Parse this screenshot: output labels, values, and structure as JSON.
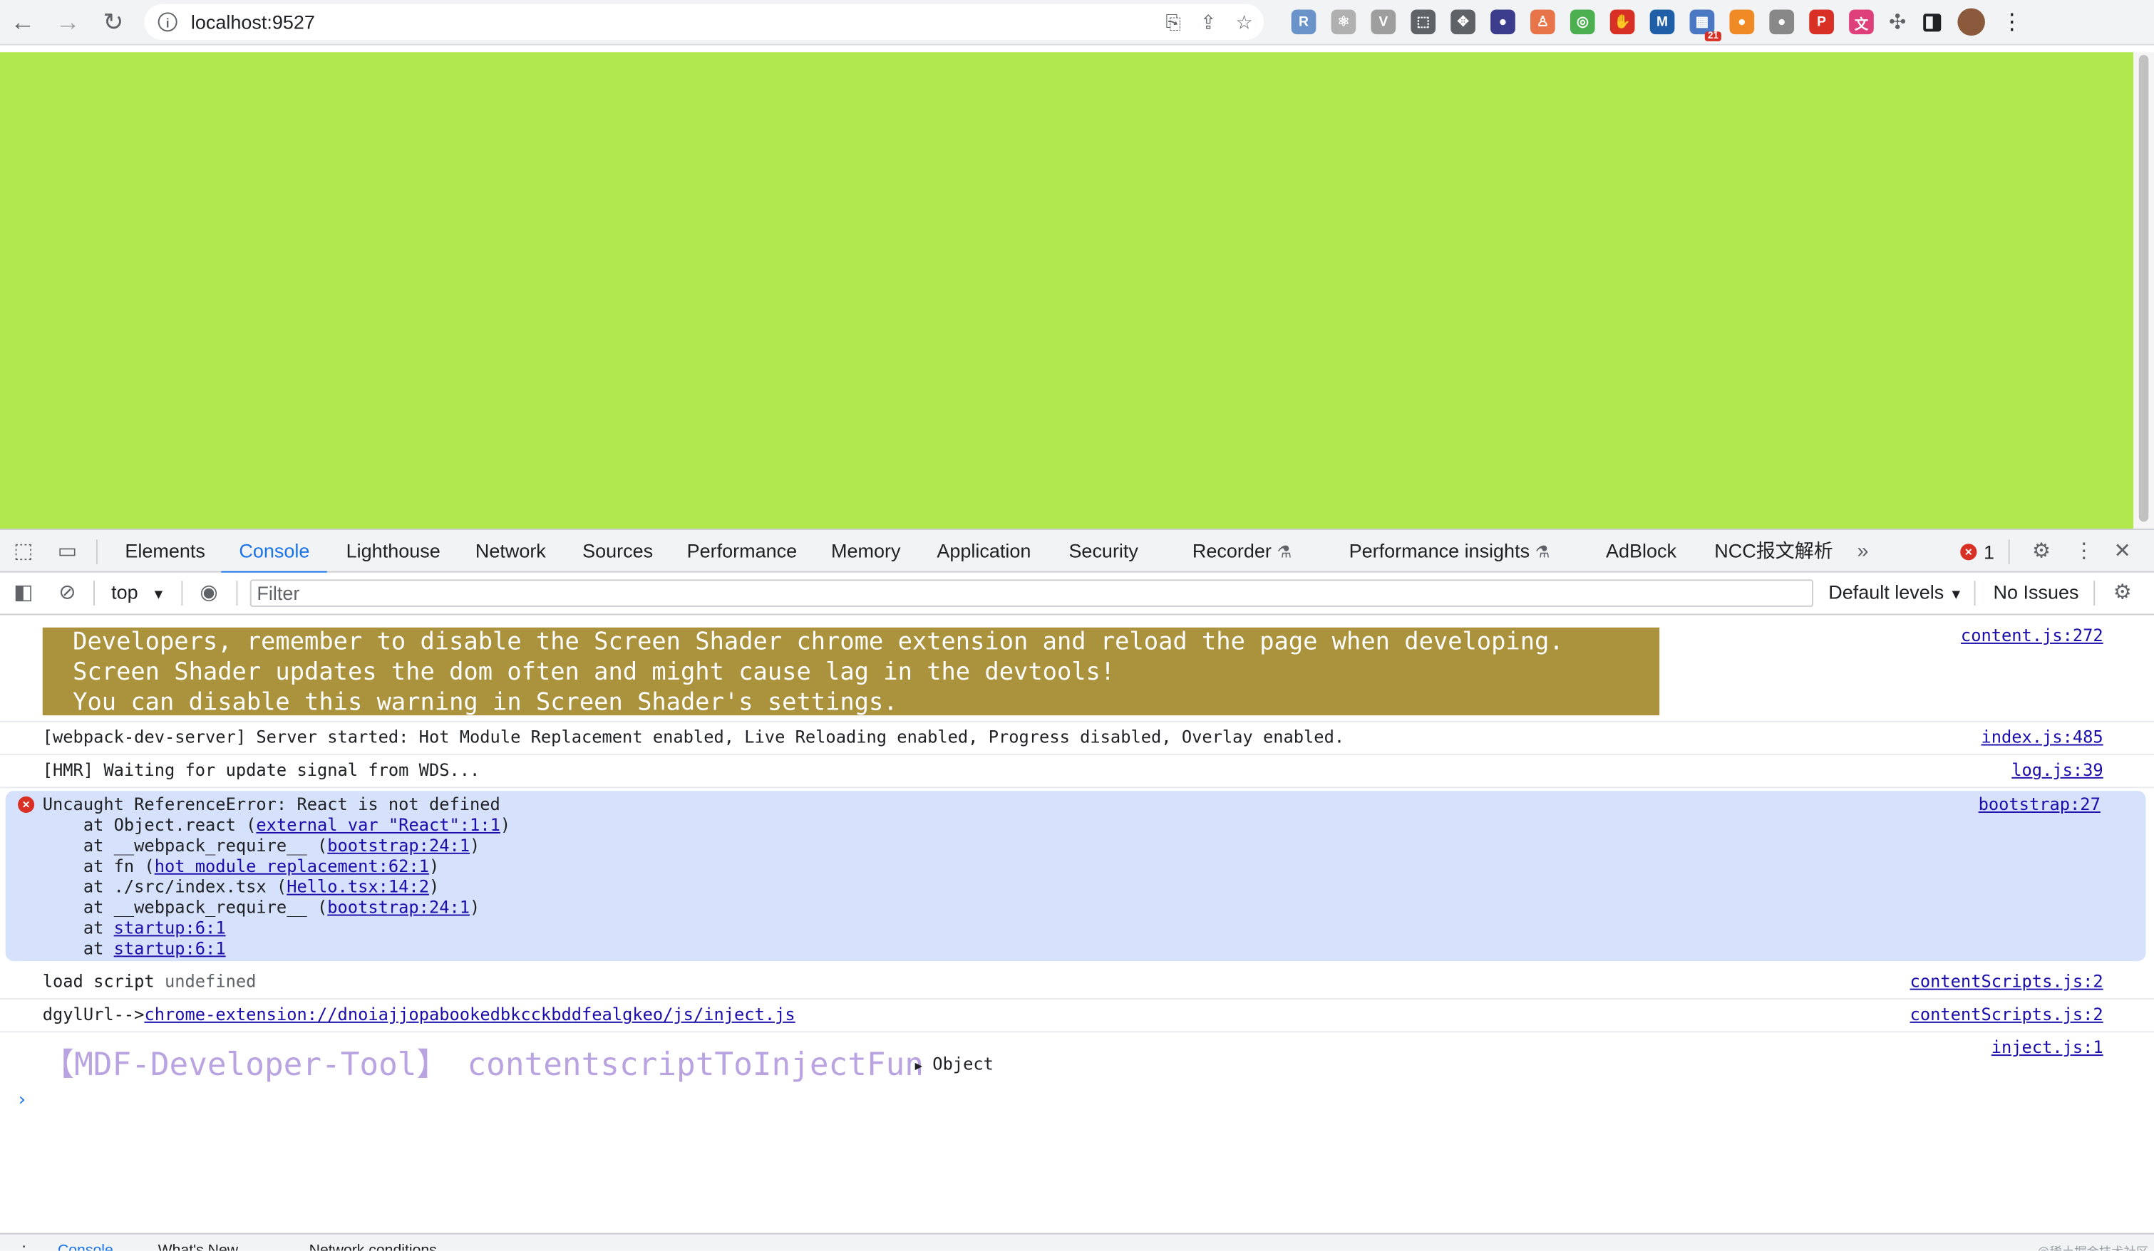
{
  "browser": {
    "url": "localhost:9527",
    "extensions": [
      {
        "icon": "r-ext-icon",
        "color": "#6a93c9",
        "glyph": "R"
      },
      {
        "icon": "react-devtools-icon",
        "color": "#b0b0b0",
        "glyph": "⚛"
      },
      {
        "icon": "vue-devtools-icon",
        "color": "#9e9e9e",
        "glyph": "V"
      },
      {
        "icon": "screenshot-icon",
        "color": "#5f6368",
        "glyph": "⬚"
      },
      {
        "icon": "move-icon",
        "color": "#5f6368",
        "glyph": "✥"
      },
      {
        "icon": "color-picker-icon",
        "color": "#3c3c8c",
        "glyph": "●"
      },
      {
        "icon": "hierarchy-icon",
        "color": "#e8744a",
        "glyph": "♙"
      },
      {
        "icon": "chrome-circle-icon",
        "color": "#4caf50",
        "glyph": "◎"
      },
      {
        "icon": "adblock-icon",
        "color": "#d93025",
        "glyph": "✋"
      },
      {
        "icon": "m-icon",
        "color": "#1f5fa8",
        "glyph": "M"
      },
      {
        "icon": "grid-badge-icon",
        "color": "#4a78c2",
        "glyph": "▦"
      },
      {
        "icon": "ball-icon",
        "color": "#f08a24",
        "glyph": "●"
      },
      {
        "icon": "gray-circle-icon",
        "color": "#888888",
        "glyph": "●"
      },
      {
        "icon": "pdf-icon",
        "color": "#d93025",
        "glyph": "P"
      },
      {
        "icon": "translate-ext-icon",
        "color": "#e0407a",
        "glyph": "文"
      }
    ],
    "badge": "21"
  },
  "devtools": {
    "tabs": [
      "Elements",
      "Console",
      "Lighthouse",
      "Network",
      "Sources",
      "Performance",
      "Memory",
      "Application",
      "Security",
      "Recorder",
      "Performance insights",
      "AdBlock",
      "NCC报文解析"
    ],
    "active_tab": "Console",
    "error_count": "1",
    "console_toolbar": {
      "context": "top",
      "filter_placeholder": "Filter",
      "levels": "Default levels",
      "issues": "No Issues"
    }
  },
  "console": {
    "banner": {
      "lines": [
        "Developers, remember to disable the Screen Shader chrome extension and reload the page when developing.",
        "Screen Shader updates the dom often and might cause lag in the devtools!",
        "You can disable this warning in Screen Shader's settings."
      ],
      "source": "content.js:272"
    },
    "wds": {
      "text": "[webpack-dev-server] Server started: Hot Module Replacement enabled, Live Reloading enabled, Progress disabled, Overlay enabled.",
      "source": "index.js:485"
    },
    "hmr": {
      "text": "[HMR] Waiting for update signal from WDS...",
      "source": "log.js:39"
    },
    "error": {
      "message": "Uncaught ReferenceError: React is not defined",
      "source": "bootstrap:27",
      "stack": [
        {
          "prefix": "    at Object.react (",
          "link": "external var \"React\":1:1",
          "suffix": ")"
        },
        {
          "prefix": "    at __webpack_require__ (",
          "link": "bootstrap:24:1",
          "suffix": ")"
        },
        {
          "prefix": "    at fn (",
          "link": "hot module replacement:62:1",
          "suffix": ")"
        },
        {
          "prefix": "    at ./src/index.tsx (",
          "link": "Hello.tsx:14:2",
          "suffix": ")"
        },
        {
          "prefix": "    at __webpack_require__ (",
          "link": "bootstrap:24:1",
          "suffix": ")"
        },
        {
          "prefix": "    at ",
          "link": "startup:6:1",
          "suffix": ""
        },
        {
          "prefix": "    at ",
          "link": "startup:6:1",
          "suffix": ""
        }
      ]
    },
    "load_script": {
      "label": "load script",
      "value": "undefined",
      "source": "contentScripts.js:2"
    },
    "dgyl": {
      "label": "dgylUrl-->",
      "link": "chrome-extension://dnoiajjopabookedbkcckbddfealgkeo/js/inject.js",
      "source": "contentScripts.js:2"
    },
    "mdf": {
      "text": "【MDF-Developer-Tool】 contentscriptToInjectFun",
      "object": "Object",
      "source": "inject.js:1"
    }
  },
  "drawer": {
    "tabs": [
      "Console",
      "What's New",
      "Network conditions"
    ],
    "watermark": "@稀土掘金技术社区"
  }
}
